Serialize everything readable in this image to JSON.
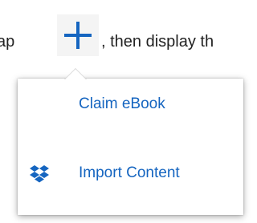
{
  "instruction": {
    "before_text": "ap",
    "after_text": ", then display th"
  },
  "popover": {
    "items": [
      {
        "label": "Claim eBook",
        "icon": null
      },
      {
        "label": "Import Content",
        "icon": "dropbox-icon"
      }
    ]
  },
  "colors": {
    "accent": "#1565c0",
    "text": "#222222",
    "icon_bg": "#f4f4f4"
  }
}
